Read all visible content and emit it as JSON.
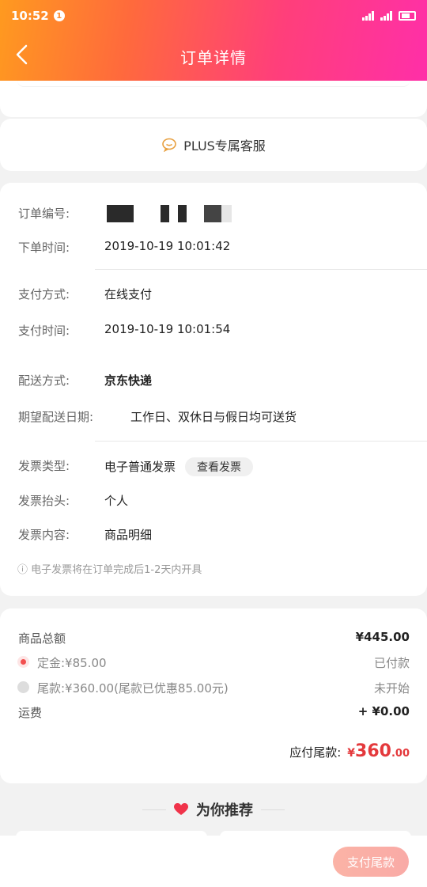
{
  "status_bar": {
    "time": "10:52",
    "badge": "1",
    "network_label": "4G"
  },
  "nav": {
    "title": "订单详情"
  },
  "plus_service": {
    "label": "PLUS专属客服"
  },
  "order": {
    "number_label": "订单编号:",
    "time_label": "下单时间:",
    "time_value": "2019-10-19 10:01:42",
    "pay_method_label": "支付方式:",
    "pay_method_value": "在线支付",
    "pay_time_label": "支付时间:",
    "pay_time_value": "2019-10-19 10:01:54",
    "delivery_label": "配送方式:",
    "delivery_value": "京东快递",
    "expected_label": "期望配送日期:",
    "expected_value": "工作日、双休日与假日均可送货",
    "invoice_type_label": "发票类型:",
    "invoice_type_value": "电子普通发票",
    "view_invoice_label": "查看发票",
    "invoice_title_label": "发票抬头:",
    "invoice_title_value": "个人",
    "invoice_content_label": "发票内容:",
    "invoice_content_value": "商品明细",
    "invoice_note": "ⓘ 电子发票将在订单完成后1-2天内开具"
  },
  "payment": {
    "total_label": "商品总额",
    "total_value": "¥445.00",
    "deposit_label": "定金:¥85.00",
    "deposit_status": "已付款",
    "balance_label": "尾款:¥360.00(尾款已优惠85.00元)",
    "balance_status": "未开始",
    "shipping_label": "运费",
    "shipping_value": "+ ¥0.00",
    "due_label": "应付尾款:",
    "due_yen": "¥",
    "due_int": "360",
    "due_dec": ".00"
  },
  "recommend": {
    "title": "为你推荐"
  },
  "bottom": {
    "pay_button_label": "支付尾款"
  },
  "colors": {
    "accent": "#e4393c",
    "header_start": "#ff9a1f",
    "header_end": "#ff2fa8"
  }
}
